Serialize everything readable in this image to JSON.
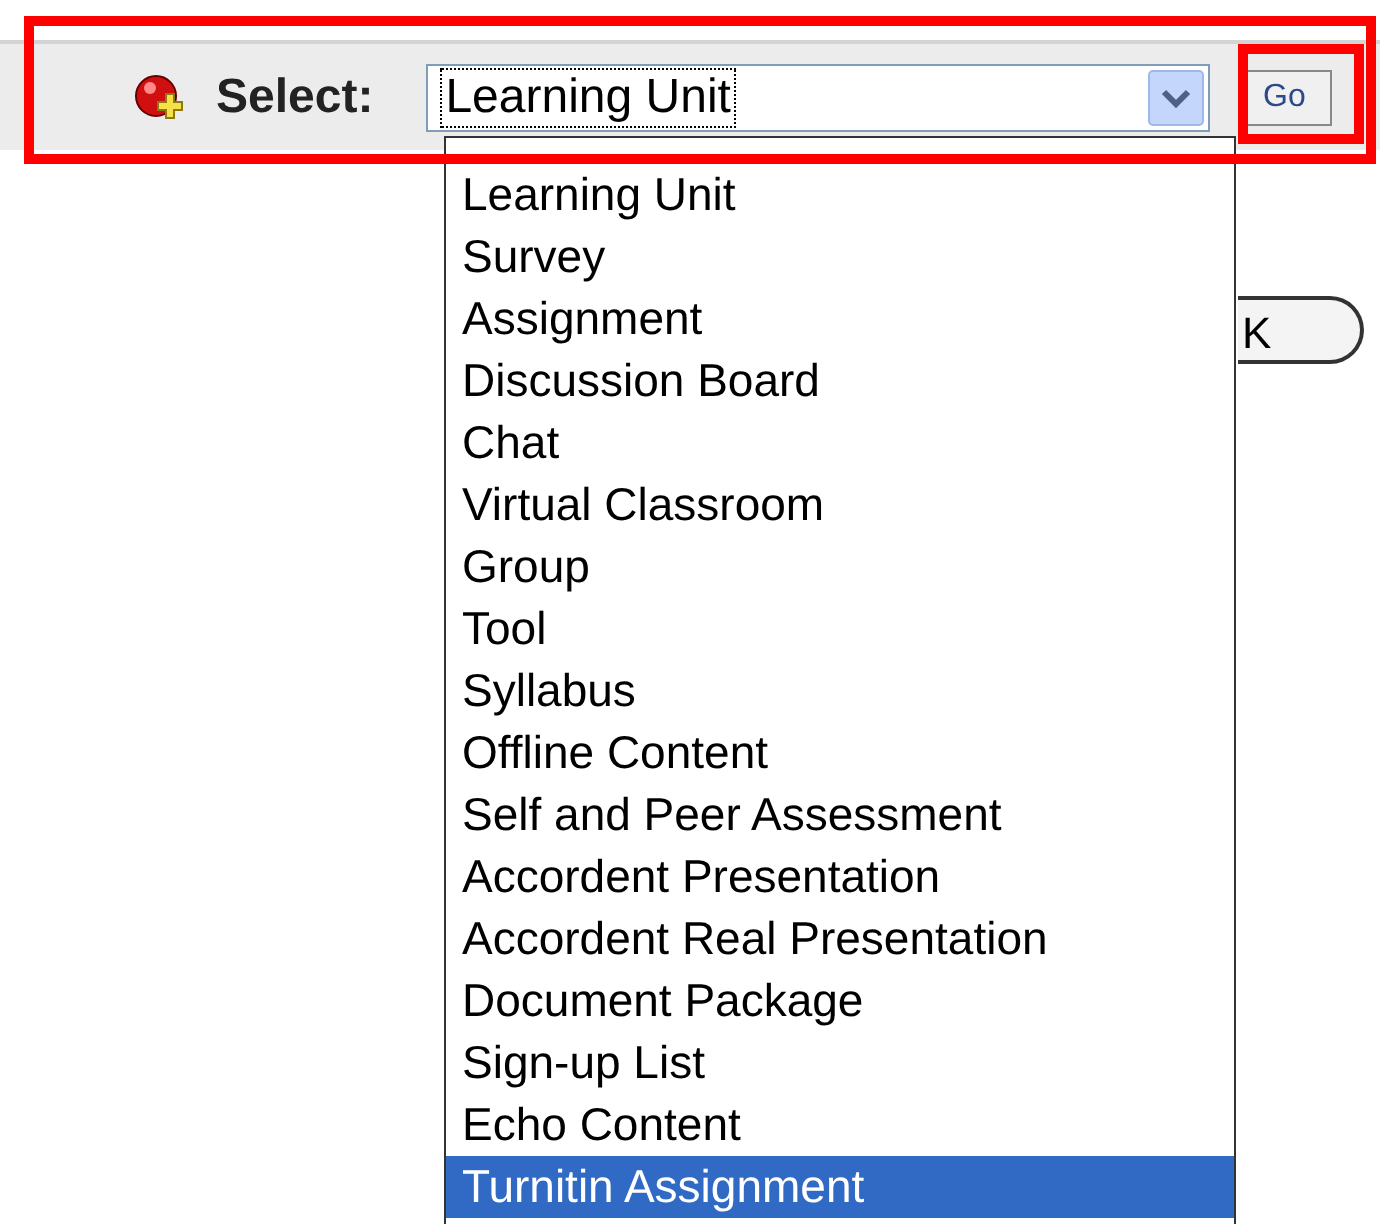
{
  "toolbar": {
    "label": "Select:",
    "field_value": "Learning Unit",
    "go_button": "Go"
  },
  "behind_button": {
    "label": "K"
  },
  "dropdown": {
    "items": [
      {
        "label": "Learning Unit",
        "selected": false
      },
      {
        "label": "Survey",
        "selected": false
      },
      {
        "label": "Assignment",
        "selected": false
      },
      {
        "label": "Discussion Board",
        "selected": false
      },
      {
        "label": "Chat",
        "selected": false
      },
      {
        "label": "Virtual Classroom",
        "selected": false
      },
      {
        "label": "Group",
        "selected": false
      },
      {
        "label": "Tool",
        "selected": false
      },
      {
        "label": "Syllabus",
        "selected": false
      },
      {
        "label": "Offline Content",
        "selected": false
      },
      {
        "label": "Self and Peer Assessment",
        "selected": false
      },
      {
        "label": "Accordent Presentation",
        "selected": false
      },
      {
        "label": "Accordent Real Presentation",
        "selected": false
      },
      {
        "label": "Document Package",
        "selected": false
      },
      {
        "label": "Sign-up List",
        "selected": false
      },
      {
        "label": "Echo Content",
        "selected": false
      },
      {
        "label": "Turnitin Assignment",
        "selected": true
      }
    ]
  }
}
